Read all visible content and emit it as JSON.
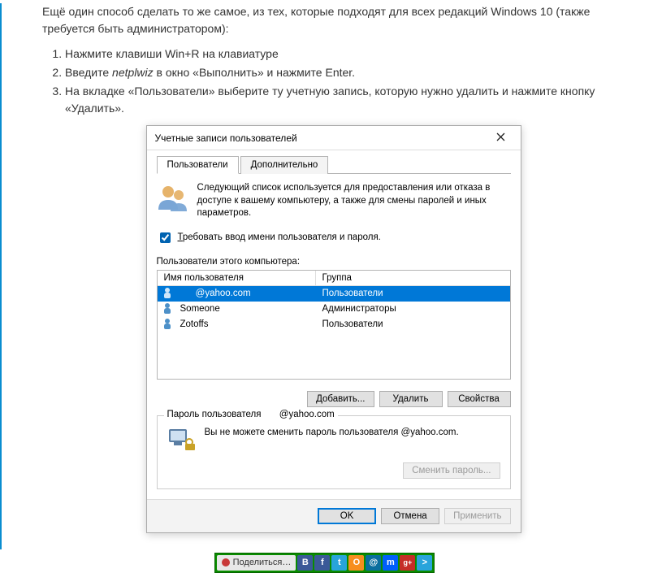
{
  "article": {
    "intro": "Ещё один способ сделать то же самое, из тех, которые подходят для всех редакций Windows 10 (также требуется быть администратором):",
    "steps": [
      "Нажмите клавиши Win+R на клавиатуре",
      {
        "pre": "Введите ",
        "kw": "netplwiz",
        "post": " в окно «Выполнить» и нажмите Enter."
      },
      "На вкладке «Пользователи» выберите ту учетную запись, которую нужно удалить и нажмите кнопку «Удалить»."
    ]
  },
  "dialog": {
    "title": "Учетные записи пользователей",
    "tabs": {
      "users": "Пользователи",
      "advanced": "Дополнительно"
    },
    "intro_text": "Следующий список используется для предоставления или отказа в доступе к вашему компьютеру, а также для смены паролей и иных параметров.",
    "require_login_label": "Требовать ввод имени пользователя и пароля.",
    "require_login_checked": true,
    "list_label": "Пользователи этого компьютера:",
    "columns": {
      "name": "Имя пользователя",
      "group": "Группа"
    },
    "rows": [
      {
        "name": "@yahoo.com",
        "group": "Пользователи",
        "selected": true,
        "indent": true
      },
      {
        "name": "Someone",
        "group": "Администраторы",
        "selected": false,
        "indent": false
      },
      {
        "name": "Zotoffs",
        "group": "Пользователи",
        "selected": false,
        "indent": false
      }
    ],
    "buttons": {
      "add": "Добавить...",
      "remove": "Удалить",
      "props": "Свойства"
    },
    "password_box": {
      "legend_prefix": "Пароль пользователя",
      "legend_user": "@yahoo.com",
      "message": "Вы не можете сменить пароль пользователя @yahoo.com.",
      "change": "Сменить пароль..."
    },
    "bottom": {
      "ok": "OK",
      "cancel": "Отмена",
      "apply": "Применить"
    }
  },
  "share": {
    "label": "Поделиться…",
    "items": [
      "В",
      "f",
      "t",
      "O",
      "@",
      "m",
      "g+",
      ">"
    ]
  }
}
